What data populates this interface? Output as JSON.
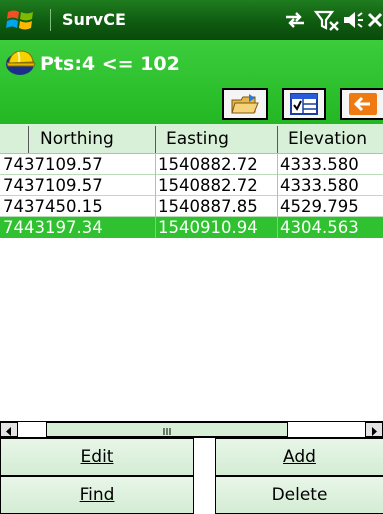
{
  "titlebar": {
    "app_title": "SurvCE",
    "icons": [
      "windows-start-icon",
      "connectivity-icon",
      "no-signal-icon",
      "volume-icon",
      "close-icon"
    ]
  },
  "header": {
    "points_label": "Pts:4 <= 102",
    "toolbar_icons": [
      "open-folder-icon",
      "spreadsheet-icon",
      "back-arrow-icon"
    ]
  },
  "table": {
    "columns": [
      "Northing",
      "Easting",
      "Elevation"
    ],
    "rows": [
      {
        "northing": "7437109.57",
        "easting": "1540882.72",
        "elevation": "4333.580"
      },
      {
        "northing": "7437109.57",
        "easting": "1540882.72",
        "elevation": "4333.580"
      },
      {
        "northing": "7437450.15",
        "easting": "1540887.85",
        "elevation": "4529.795"
      },
      {
        "northing": "7443197.34",
        "easting": "1540910.94",
        "elevation": "4304.563"
      }
    ],
    "selected_row": 3
  },
  "buttons": {
    "edit": "Edit",
    "add": "Add",
    "find": "Find",
    "delete": "Delete"
  },
  "colors": {
    "titlebar": "#0f5c10",
    "header": "#2cc02c",
    "selection": "#2fc12f",
    "back_button_accent": "#f07a12"
  }
}
